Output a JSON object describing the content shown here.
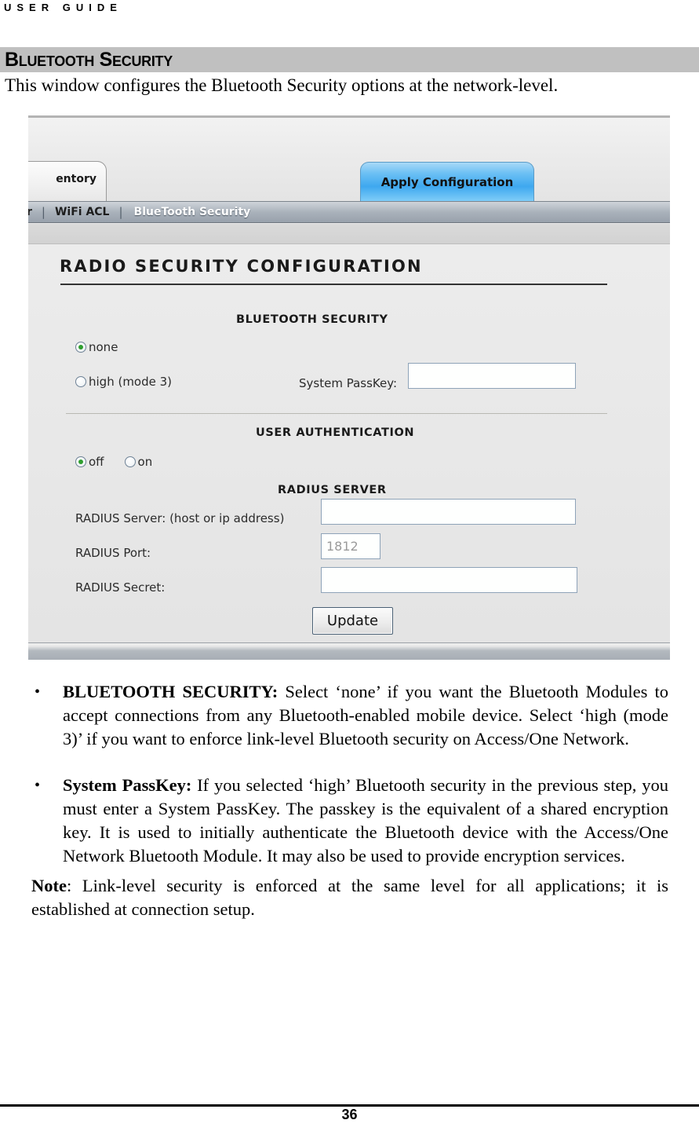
{
  "document": {
    "running_head": "USER GUIDE",
    "section_title": "Bluetooth Security",
    "intro": "This window configures the Bluetooth Security options at the network-level.",
    "page_number": "36"
  },
  "screenshot": {
    "tab_label": "entory",
    "apply_button": "Apply Configuration",
    "nav": {
      "item_truncated": "r",
      "separator": "|",
      "item_wifi_acl": "WiFi ACL",
      "item_active": "BlueTooth Security"
    },
    "panel_title": "RADIO SECURITY CONFIGURATION",
    "bluetooth_security": {
      "heading": "BLUETOOTH SECURITY",
      "options": [
        {
          "label": "none",
          "selected": true
        },
        {
          "label": "high (mode 3)",
          "selected": false
        }
      ],
      "passkey_label": "System PassKey:",
      "passkey_value": ""
    },
    "user_authentication": {
      "heading": "USER AUTHENTICATION",
      "options": [
        {
          "label": "off",
          "selected": true
        },
        {
          "label": "on",
          "selected": false
        }
      ]
    },
    "radius_server": {
      "heading": "RADIUS SERVER",
      "fields": [
        {
          "label": "RADIUS Server: (host or ip address)",
          "value": ""
        },
        {
          "label": "RADIUS Port:",
          "value": "1812"
        },
        {
          "label": "RADIUS Secret:",
          "value": ""
        }
      ],
      "update_button": "Update"
    },
    "colors": {
      "apply_button_accent": "#3ea8ef",
      "radio_selected_dot": "#2f9e2f",
      "nav_bar": "#aab2bb",
      "panel_background": "#e8e8e8"
    }
  },
  "body": {
    "bullets": [
      {
        "term": "BLUETOOTH SECURITY:",
        "text": " Select ‘none’ if you want the Bluetooth Modules to accept connections from any Bluetooth-enabled mobile device. Select ‘high (mode 3)’ if you want to enforce link-level Bluetooth security on Access/One Network."
      },
      {
        "term": "System PassKey:",
        "text": " If you selected ‘high’ Bluetooth security in the previous step, you must enter a System PassKey. The passkey is the equivalent of a shared encryption key. It is used to initially authenticate the Bluetooth device with the Access/One Network Bluetooth Module. It may also be used to provide encryption services."
      }
    ],
    "note": {
      "term": "Note",
      "text": ": Link-level security is enforced at the same level for all applications; it is established at connection setup."
    }
  }
}
